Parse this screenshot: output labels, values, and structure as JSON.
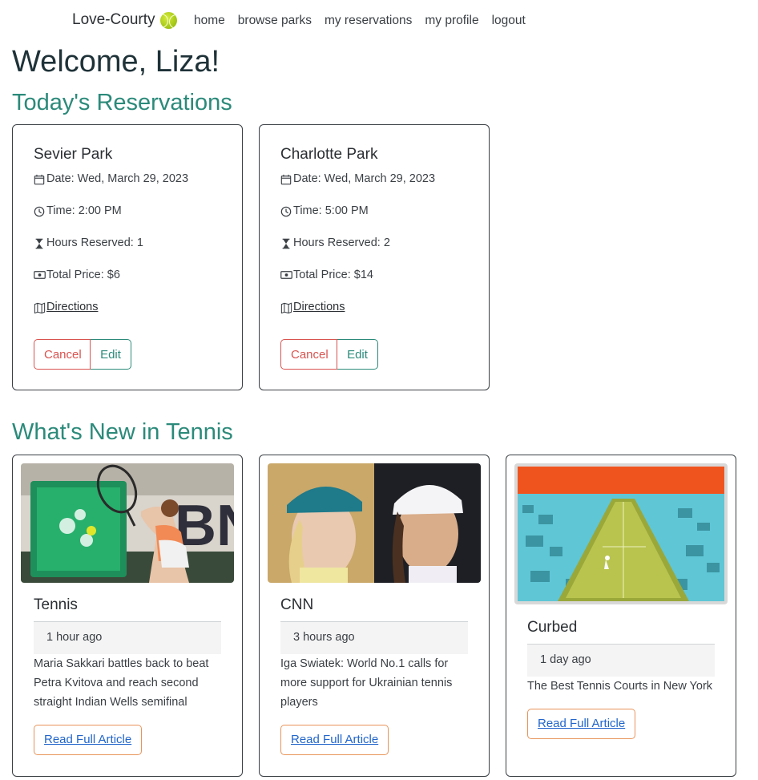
{
  "nav": {
    "brand": "Love-Courty",
    "links": [
      "home",
      "browse parks",
      "my reservations",
      "my profile",
      "logout"
    ]
  },
  "welcome": "Welcome, Liza!",
  "sections": {
    "todays": "Today's Reservations",
    "news": "What's New in Tennis"
  },
  "reservations": [
    {
      "park": "Sevier Park",
      "date": "Date: Wed, March 29, 2023",
      "time": "Time: 2:00 PM",
      "hours": "Hours Reserved: 1",
      "price": "Total Price: $6",
      "directions": "Directions",
      "cancel": "Cancel",
      "edit": "Edit"
    },
    {
      "park": "Charlotte Park",
      "date": "Date: Wed, March 29, 2023",
      "time": "Time: 5:00 PM",
      "hours": "Hours Reserved: 2",
      "price": "Total Price: $14",
      "directions": "Directions",
      "cancel": "Cancel",
      "edit": "Edit"
    }
  ],
  "news": [
    {
      "source": "Tennis",
      "time": "1 hour ago",
      "desc": "Maria Sakkari battles back to beat Petra Kvitova and reach second straight Indian Wells semifinal",
      "read": "Read Full Article",
      "img_text": "BN"
    },
    {
      "source": "CNN",
      "time": "3 hours ago",
      "desc": "Iga Swiatek: World No.1 calls for more support for Ukrainian tennis players",
      "read": "Read Full Article"
    },
    {
      "source": "Curbed",
      "time": "1 day ago",
      "desc": "The Best Tennis Courts in New York",
      "read": "Read Full Article"
    }
  ],
  "colors": {
    "accent": "#2b8a7a",
    "cancel": "#d9534f",
    "read_border": "#e8945a",
    "link": "#2266cc"
  }
}
